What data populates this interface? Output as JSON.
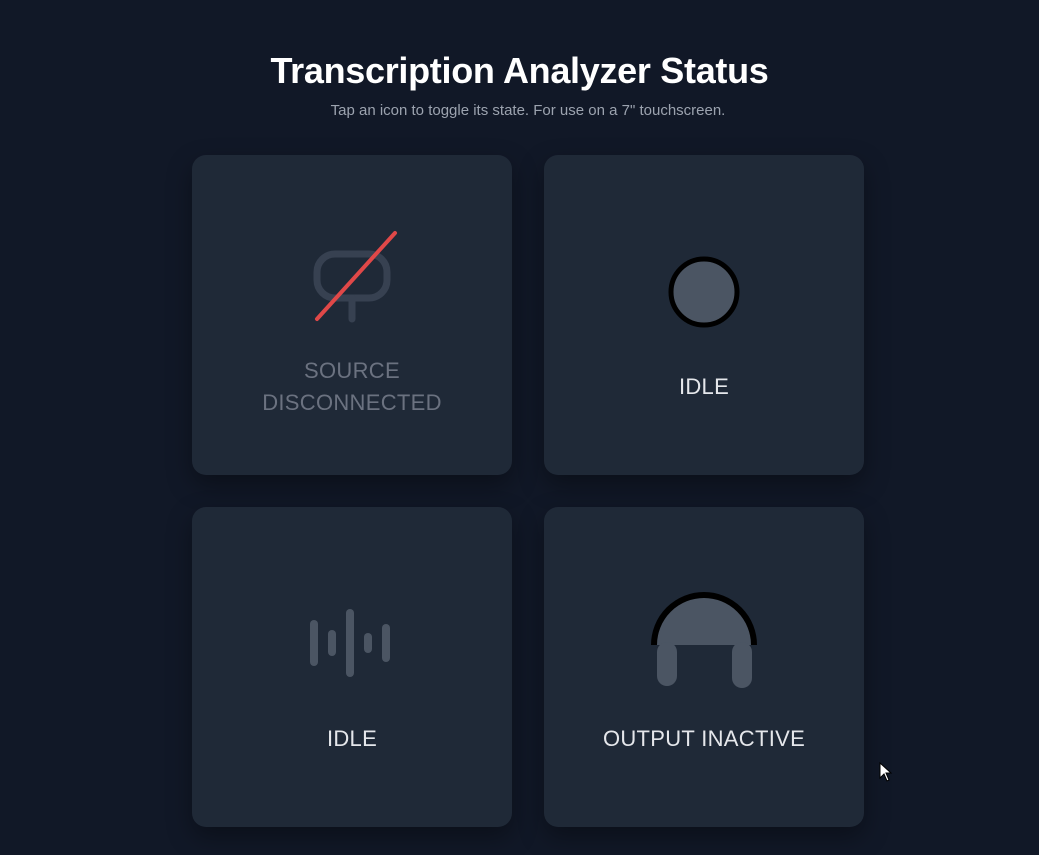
{
  "header": {
    "title": "Transcription Analyzer Status",
    "subtitle": "Tap an icon to toggle its state. For use on a 7\" touchscreen."
  },
  "tiles": [
    {
      "id": "source",
      "icon": "microphone-slash-icon",
      "label_line1": "SOURCE",
      "label_line2": "DISCONNECTED",
      "state": "disconnected"
    },
    {
      "id": "recording",
      "icon": "record-circle-icon",
      "label": "IDLE",
      "state": "idle"
    },
    {
      "id": "audio",
      "icon": "waveform-icon",
      "label": "IDLE",
      "state": "idle"
    },
    {
      "id": "output",
      "icon": "headphones-icon",
      "label": "OUTPUT INACTIVE",
      "state": "inactive"
    }
  ],
  "colors": {
    "background": "#111827",
    "card": "#1f2937",
    "icon_muted": "#374151",
    "icon_idle": "#4b5563",
    "slash": "#ef4444",
    "label": "#e5e7eb",
    "label_dim": "#6b7280"
  }
}
